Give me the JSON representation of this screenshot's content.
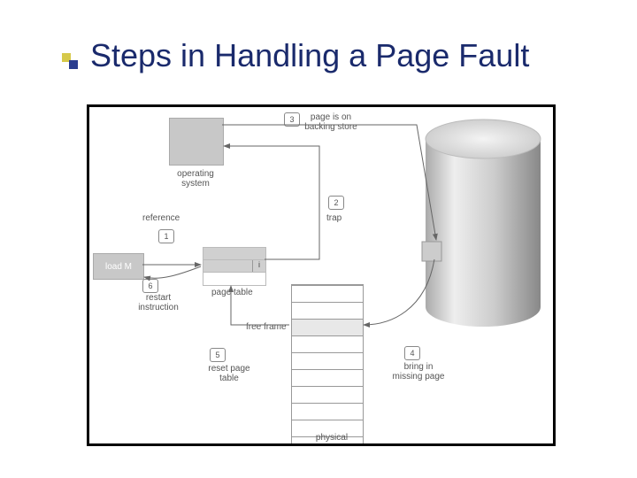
{
  "title": "Steps in Handling a Page Fault",
  "diagram": {
    "os_label": "operating\nsystem",
    "reference_label": "reference",
    "load_label": "load M",
    "restart_label": "restart\ninstruction",
    "page_table_label": "page table",
    "page_table_bit": "i",
    "free_frame_label": "free frame",
    "reset_label": "reset page\ntable",
    "physical_memory_label": "physical\nmemory",
    "trap_label": "trap",
    "backing_store_label": "page is on\nbacking store",
    "bring_in_label": "bring in\nmissing page",
    "steps": {
      "s1": "1",
      "s2": "2",
      "s3": "3",
      "s4": "4",
      "s5": "5",
      "s6": "6"
    }
  }
}
